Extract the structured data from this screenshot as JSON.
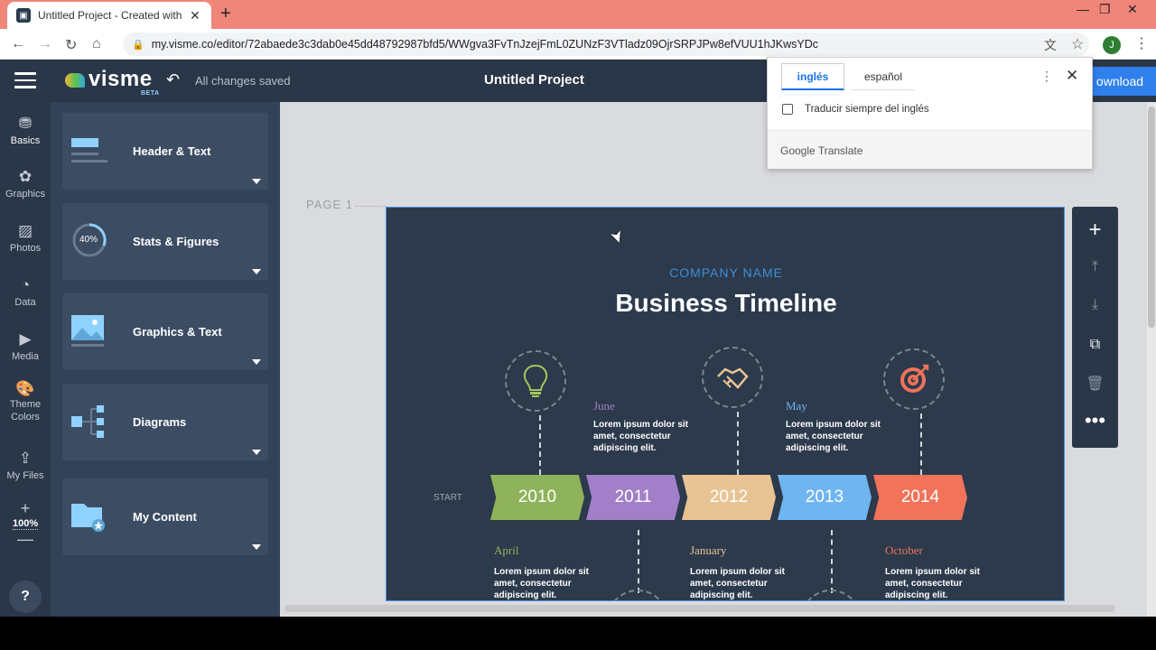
{
  "browser": {
    "tab_title": "Untitled Project - Created with Visme",
    "url": "my.visme.co/editor/72abaede3c3dab0e45dd48792987bfd5/WWgva3FvTnJzejFmL0ZUNzF3VTladz09OjrSRPJPw8efVUU1hJKwsYDc",
    "avatar_letter": "J"
  },
  "app": {
    "logo": "visme",
    "logo_badge": "BETA",
    "save_status": "All changes saved",
    "project_title": "Untitled Project",
    "download_label": "ownload"
  },
  "rail": {
    "items": [
      {
        "label": "Basics",
        "icon": "basics-icon"
      },
      {
        "label": "Graphics",
        "icon": "graphics-icon"
      },
      {
        "label": "Photos",
        "icon": "photos-icon"
      },
      {
        "label": "Data",
        "icon": "data-icon"
      },
      {
        "label": "Media",
        "icon": "media-icon"
      },
      {
        "label": "Theme Colors",
        "icon": "palette-icon"
      },
      {
        "label": "My Files",
        "icon": "files-icon"
      }
    ],
    "zoom": "100%",
    "help": "?"
  },
  "panel": {
    "cards": [
      {
        "label": "Header & Text"
      },
      {
        "label": "Stats & Figures",
        "badge": "40%"
      },
      {
        "label": "Graphics & Text"
      },
      {
        "label": "Diagrams"
      },
      {
        "label": "My Content"
      }
    ]
  },
  "canvas": {
    "page_label": "PAGE 1",
    "company": "COMPANY NAME",
    "title": "Business Timeline",
    "start": "START",
    "years": [
      {
        "label": "2010",
        "color": "#8fb35a"
      },
      {
        "label": "2011",
        "color": "#a27fc8"
      },
      {
        "label": "2012",
        "color": "#e8c494"
      },
      {
        "label": "2013",
        "color": "#6fb5f0"
      },
      {
        "label": "2014",
        "color": "#f0735a"
      }
    ],
    "top_events": [
      {
        "month": "June",
        "color": "#a27fc8",
        "text": "Lorem ipsum dolor sit amet, consectetur adipiscing elit."
      },
      {
        "month": "May",
        "color": "#6fb5f0",
        "text": "Lorem ipsum dolor sit amet, consectetur adipiscing elit."
      }
    ],
    "bottom_events": [
      {
        "month": "April",
        "color": "#8fb35a",
        "text": "Lorem ipsum dolor sit amet, consectetur adipiscing elit."
      },
      {
        "month": "January",
        "color": "#e8c494",
        "text": "Lorem ipsum dolor sit amet, consectetur adipiscing elit."
      },
      {
        "month": "October",
        "color": "#f0735a",
        "text": "Lorem ipsum dolor sit amet, consectetur adipiscing elit."
      }
    ]
  },
  "translate": {
    "lang_from": "inglés",
    "lang_to": "español",
    "always_translate": "Traducir siempre del inglés",
    "brand": "Google Translate"
  }
}
